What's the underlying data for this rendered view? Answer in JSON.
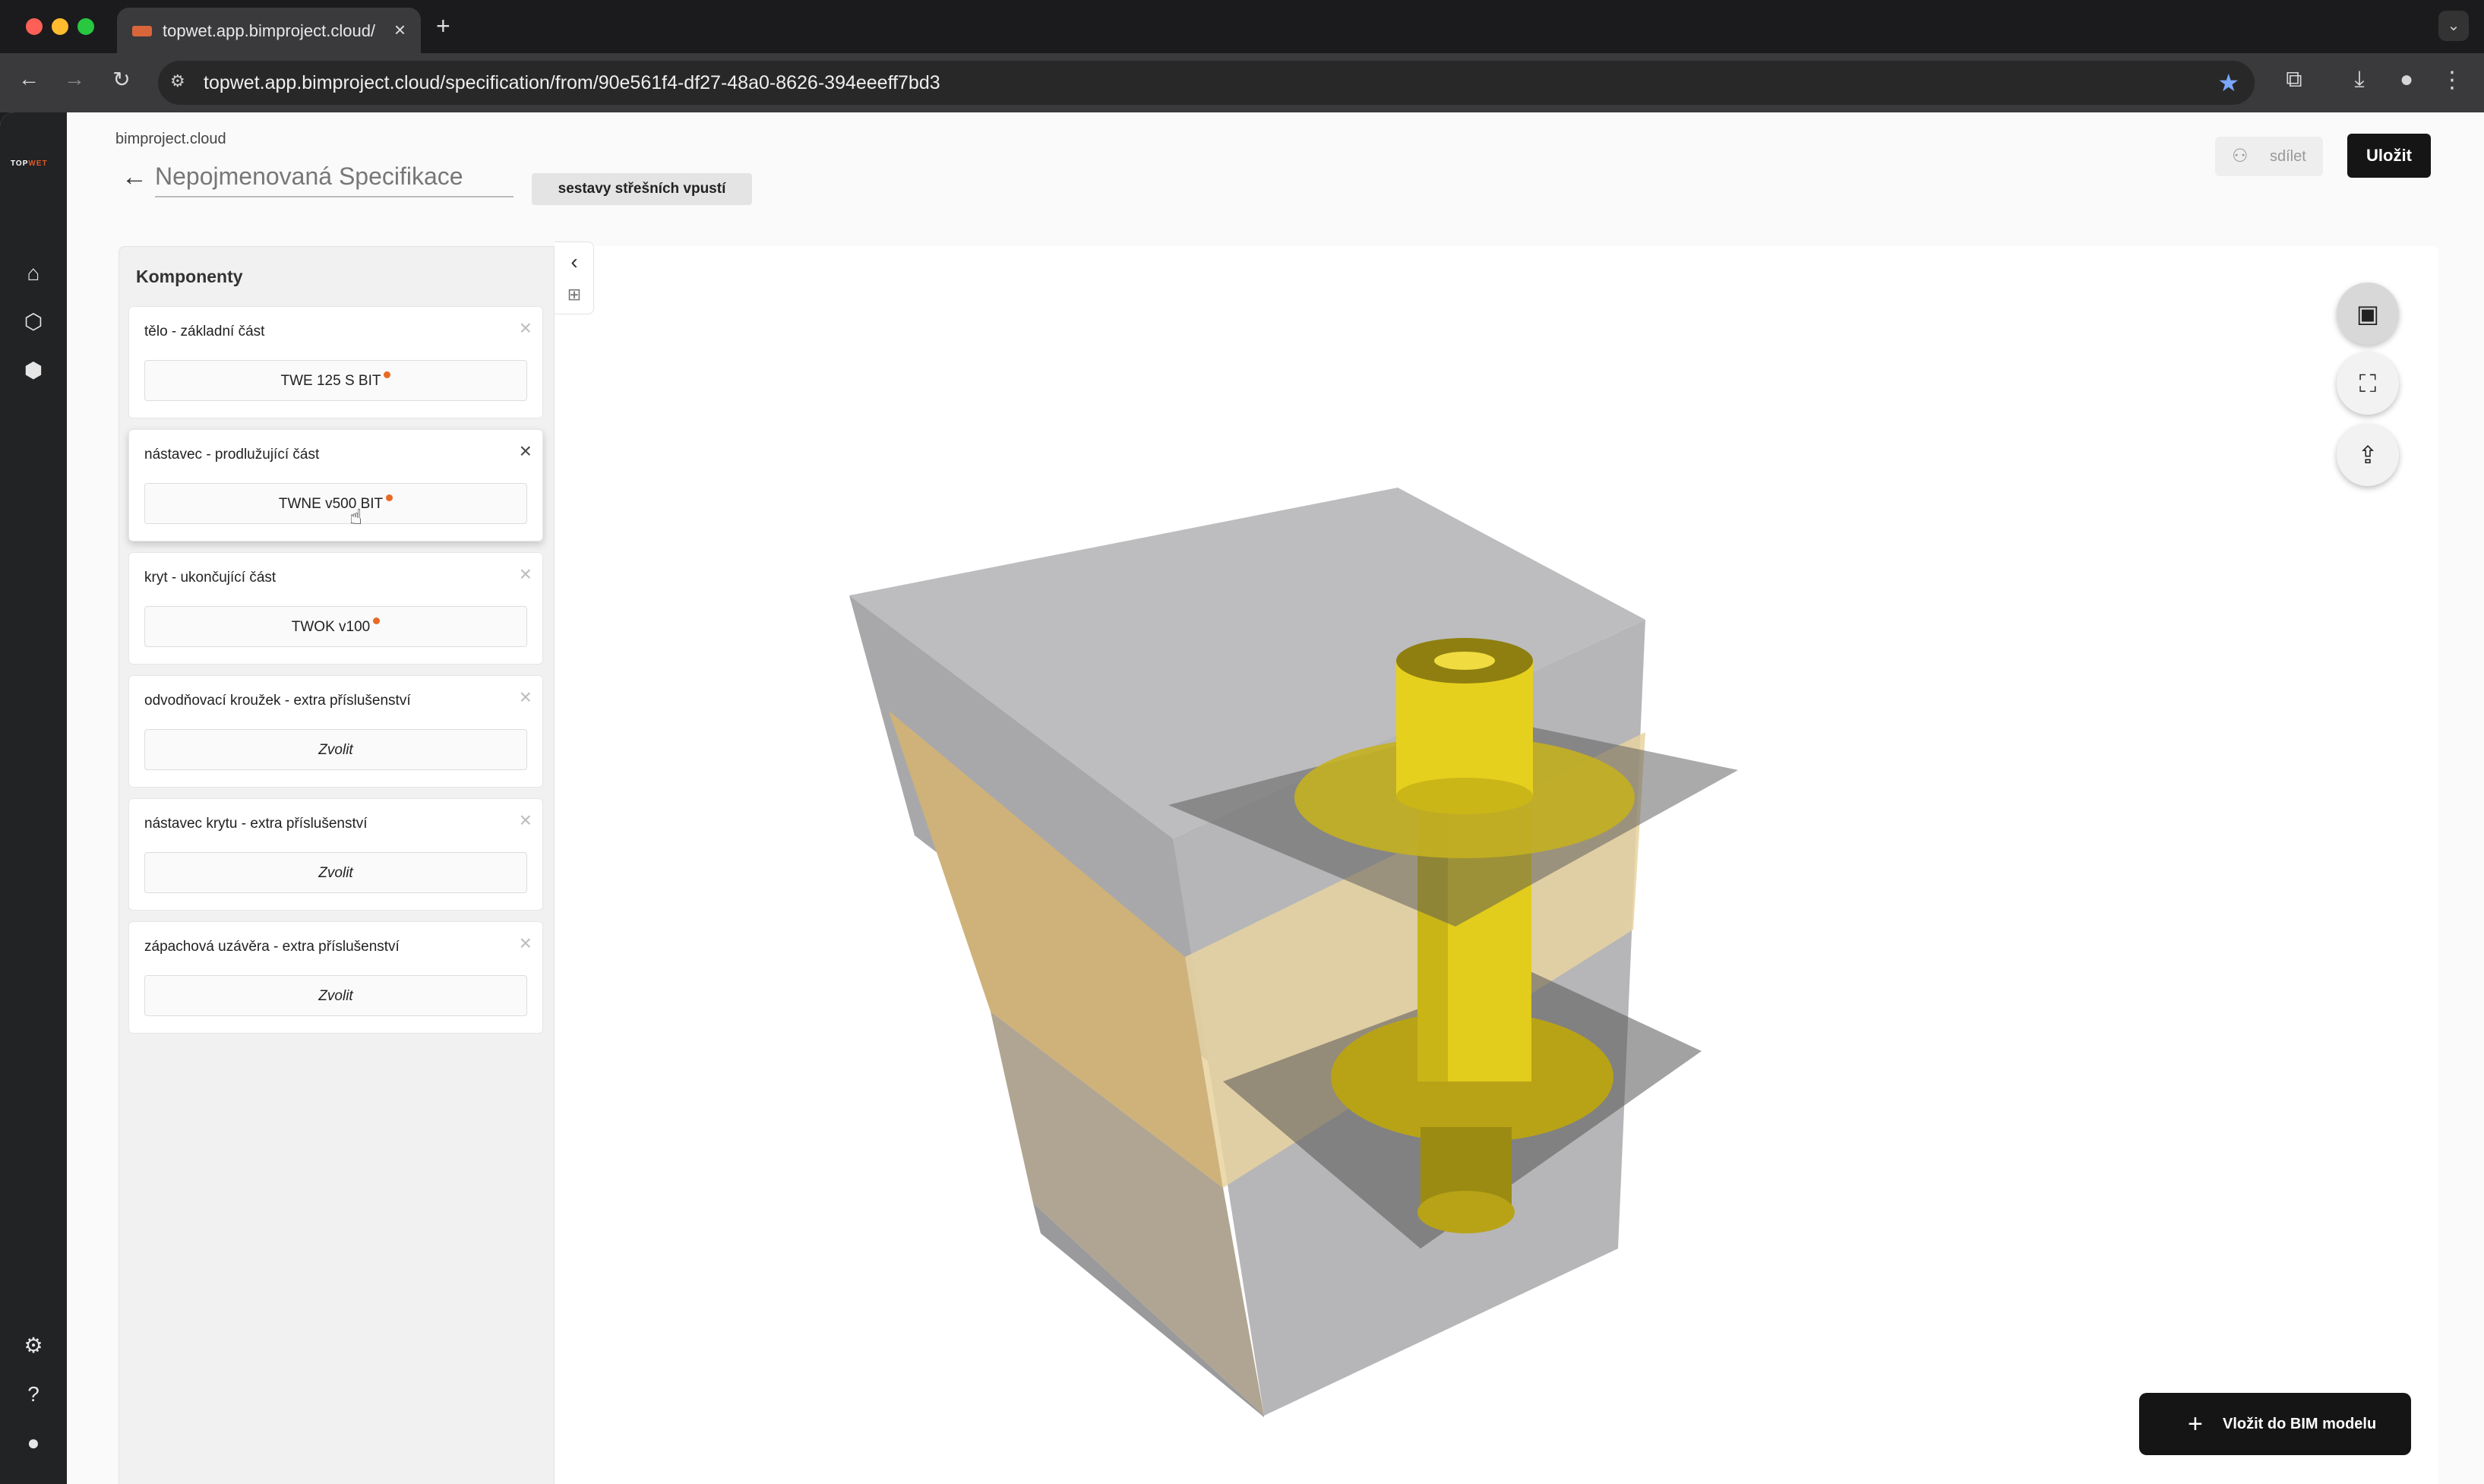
{
  "browser": {
    "tab_title": "topwet.app.bimproject.cloud/",
    "tab_close": "×",
    "new_tab": "+",
    "url": "topwet.app.bimproject.cloud/specification/from/90e561f4-df27-48a0-8626-394eeeff7bd3"
  },
  "app": {
    "brand": "bimproject.cloud",
    "logo_a": "TOP",
    "logo_b": "WET",
    "spec_title_placeholder": "Nepojmenovaná Specifikace",
    "category_tag": "sestavy střešních vpustí",
    "share_label": "sdílet",
    "save_label": "Uložit",
    "panel_title": "Komponenty",
    "components": [
      {
        "label": "tělo - základní část",
        "value": "TWE 125 S BIT",
        "required": true
      },
      {
        "label": "nástavec - prodlužující část",
        "value": "TWNE v500 BIT",
        "required": true
      },
      {
        "label": "kryt - ukončující část",
        "value": "TWOK v100",
        "required": true
      },
      {
        "label": "odvodňovací kroužek - extra příslušenství",
        "value": "Zvolit",
        "required": false
      },
      {
        "label": "nástavec krytu - extra příslušenství",
        "value": "Zvolit",
        "required": false
      },
      {
        "label": "zápachová uzávěra - extra příslušenství",
        "value": "Zvolit",
        "required": false
      }
    ],
    "insert_bim_label": "Vložit do BIM modelu"
  },
  "colors": {
    "accent_dot": "#e86a24",
    "dark_button": "#151515",
    "rail": "#222325",
    "model_yellow": "#e2cc1c"
  }
}
